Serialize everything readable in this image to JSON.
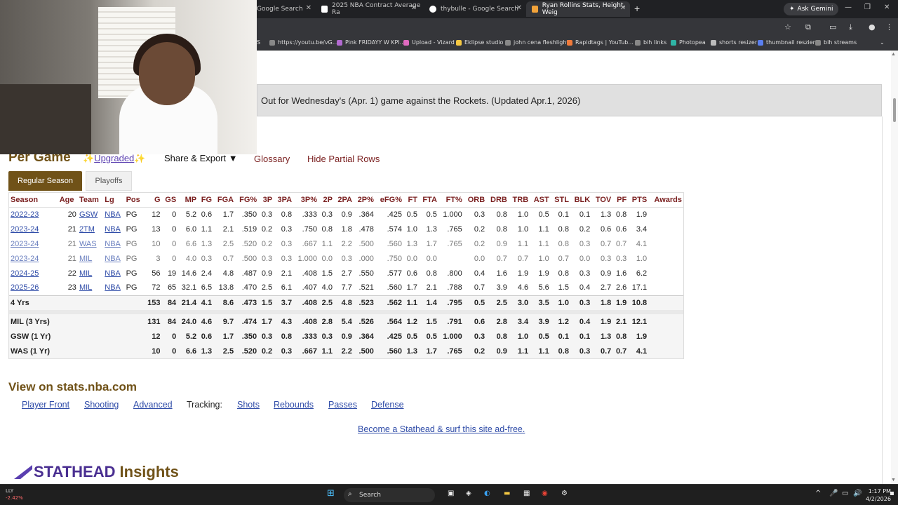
{
  "browser": {
    "tabs": [
      {
        "title": "Google Search",
        "icon": "google-icon"
      },
      {
        "title": "2025 NBA Contract Average Ra",
        "icon": "page-icon"
      },
      {
        "title": "thybulle - Google Search",
        "icon": "google-icon"
      },
      {
        "title": "Ryan Rollins Stats, Height, Weig",
        "icon": "bbref-icon"
      }
    ],
    "ask_gemini": "Ask Gemini",
    "bookmarks": [
      "S",
      "https://youtu.be/vG...",
      "Pink FRIDAYY W KPI...",
      "Upload - Vizard",
      "Eklipse studio",
      "john cena fleshlight",
      "Rapidtags | YouTub...",
      "bih links",
      "Photopea",
      "shorts resizer",
      "thumbnail reszier",
      "bih streams"
    ]
  },
  "alert": {
    "text": "Out for Wednesday's (Apr. 1) game against the Rockets. (Updated Apr.1, 2026)"
  },
  "section": {
    "title": "Per Game",
    "upgraded": "Upgraded",
    "share_export": "Share & Export ▼",
    "glossary": "Glossary",
    "hide_partial": "Hide Partial Rows",
    "tab_regular": "Regular Season",
    "tab_playoffs": "Playoffs"
  },
  "table": {
    "headers": [
      "Season",
      "Age",
      "Team",
      "Lg",
      "Pos",
      "G",
      "GS",
      "MP",
      "FG",
      "FGA",
      "FG%",
      "3P",
      "3PA",
      "3P%",
      "2P",
      "2PA",
      "2P%",
      "eFG%",
      "FT",
      "FTA",
      "FT%",
      "ORB",
      "DRB",
      "TRB",
      "AST",
      "STL",
      "BLK",
      "TOV",
      "PF",
      "PTS",
      "Awards"
    ],
    "rows": [
      [
        "2022-23",
        "20",
        "GSW",
        "NBA",
        "PG",
        "12",
        "0",
        "5.2",
        "0.6",
        "1.7",
        ".350",
        "0.3",
        "0.8",
        ".333",
        "0.3",
        "0.9",
        ".364",
        ".425",
        "0.5",
        "0.5",
        "1.000",
        "0.3",
        "0.8",
        "1.0",
        "0.5",
        "0.1",
        "0.1",
        "1.3",
        "0.8",
        "1.9",
        ""
      ],
      [
        "2023-24",
        "21",
        "2TM",
        "NBA",
        "PG",
        "13",
        "0",
        "6.0",
        "1.1",
        "2.1",
        ".519",
        "0.2",
        "0.3",
        ".750",
        "0.8",
        "1.8",
        ".478",
        ".574",
        "1.0",
        "1.3",
        ".765",
        "0.2",
        "0.8",
        "1.0",
        "1.1",
        "0.8",
        "0.2",
        "0.6",
        "0.6",
        "3.4",
        ""
      ],
      [
        "2023-24",
        "21",
        "WAS",
        "NBA",
        "PG",
        "10",
        "0",
        "6.6",
        "1.3",
        "2.5",
        ".520",
        "0.2",
        "0.3",
        ".667",
        "1.1",
        "2.2",
        ".500",
        ".560",
        "1.3",
        "1.7",
        ".765",
        "0.2",
        "0.9",
        "1.1",
        "1.1",
        "0.8",
        "0.3",
        "0.7",
        "0.7",
        "4.1",
        ""
      ],
      [
        "2023-24",
        "21",
        "MIL",
        "NBA",
        "PG",
        "3",
        "0",
        "4.0",
        "0.3",
        "0.7",
        ".500",
        "0.3",
        "0.3",
        "1.000",
        "0.0",
        "0.3",
        ".000",
        ".750",
        "0.0",
        "0.0",
        "",
        "0.0",
        "0.7",
        "0.7",
        "1.0",
        "0.7",
        "0.0",
        "0.3",
        "0.3",
        "1.0",
        ""
      ],
      [
        "2024-25",
        "22",
        "MIL",
        "NBA",
        "PG",
        "56",
        "19",
        "14.6",
        "2.4",
        "4.8",
        ".487",
        "0.9",
        "2.1",
        ".408",
        "1.5",
        "2.7",
        ".550",
        ".577",
        "0.6",
        "0.8",
        ".800",
        "0.4",
        "1.6",
        "1.9",
        "1.9",
        "0.8",
        "0.3",
        "0.9",
        "1.6",
        "6.2",
        ""
      ],
      [
        "2025-26",
        "23",
        "MIL",
        "NBA",
        "PG",
        "72",
        "65",
        "32.1",
        "6.5",
        "13.8",
        ".470",
        "2.5",
        "6.1",
        ".407",
        "4.0",
        "7.7",
        ".521",
        ".560",
        "1.7",
        "2.1",
        ".788",
        "0.7",
        "3.9",
        "4.6",
        "5.6",
        "1.5",
        "0.4",
        "2.7",
        "2.6",
        "17.1",
        ""
      ]
    ],
    "career": [
      "4 Yrs",
      "",
      "",
      "",
      "",
      "153",
      "84",
      "21.4",
      "4.1",
      "8.6",
      ".473",
      "1.5",
      "3.7",
      ".408",
      "2.5",
      "4.8",
      ".523",
      ".562",
      "1.1",
      "1.4",
      ".795",
      "0.5",
      "2.5",
      "3.0",
      "3.5",
      "1.0",
      "0.3",
      "1.8",
      "1.9",
      "10.8",
      ""
    ],
    "teams": [
      [
        "MIL (3 Yrs)",
        "",
        "",
        "",
        "",
        "131",
        "84",
        "24.0",
        "4.6",
        "9.7",
        ".474",
        "1.7",
        "4.3",
        ".408",
        "2.8",
        "5.4",
        ".526",
        ".564",
        "1.2",
        "1.5",
        ".791",
        "0.6",
        "2.8",
        "3.4",
        "3.9",
        "1.2",
        "0.4",
        "1.9",
        "2.1",
        "12.1",
        ""
      ],
      [
        "GSW (1 Yr)",
        "",
        "",
        "",
        "",
        "12",
        "0",
        "5.2",
        "0.6",
        "1.7",
        ".350",
        "0.3",
        "0.8",
        ".333",
        "0.3",
        "0.9",
        ".364",
        ".425",
        "0.5",
        "0.5",
        "1.000",
        "0.3",
        "0.8",
        "1.0",
        "0.5",
        "0.1",
        "0.1",
        "1.3",
        "0.8",
        "1.9",
        ""
      ],
      [
        "WAS (1 Yr)",
        "",
        "",
        "",
        "",
        "10",
        "0",
        "6.6",
        "1.3",
        "2.5",
        ".520",
        "0.2",
        "0.3",
        ".667",
        "1.1",
        "2.2",
        ".500",
        ".560",
        "1.3",
        "1.7",
        ".765",
        "0.2",
        "0.9",
        "1.1",
        "1.1",
        "0.8",
        "0.3",
        "0.7",
        "0.7",
        "4.1",
        ""
      ]
    ]
  },
  "nba": {
    "title": "View on stats.nba.com",
    "player_front": "Player Front",
    "shooting": "Shooting",
    "advanced": "Advanced",
    "tracking": "Tracking:",
    "shots": "Shots",
    "rebounds": "Rebounds",
    "passes": "Passes",
    "defense": "Defense",
    "ad": "Become a Stathead & surf this site ad-free."
  },
  "stathead": {
    "brand": "STATHEAD",
    "insights": "Insights"
  },
  "taskbar": {
    "ticker": "LLY",
    "ticker_change": "-2.42%",
    "search": "Search",
    "time": "1:17 PM",
    "date": "4/2/2026"
  }
}
